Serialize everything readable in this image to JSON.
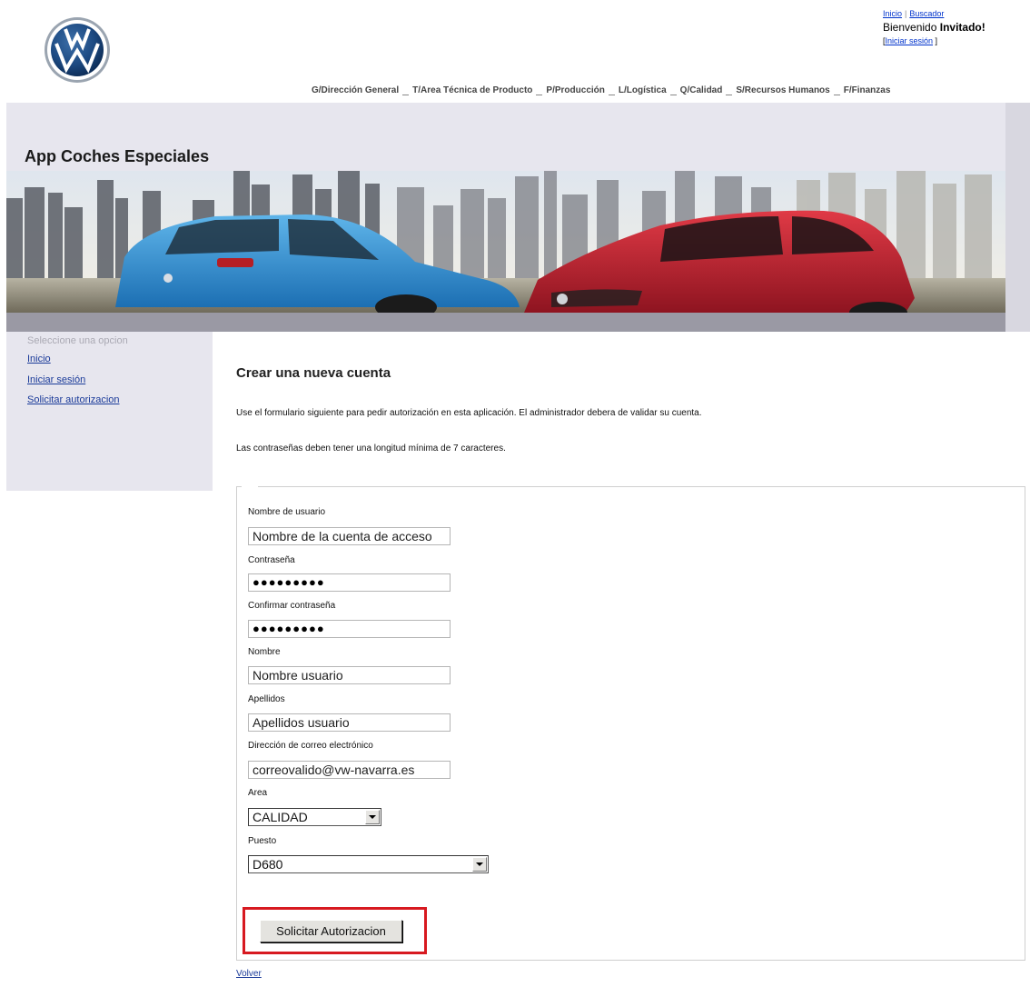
{
  "header": {
    "brand_logo": "volkswagen-logo",
    "top_links": {
      "inicio": "Inicio",
      "separator": "|",
      "buscador": "Buscador"
    },
    "welcome_text": "Bienvenido",
    "welcome_user": "Invitado!",
    "login_open": "[",
    "login_link": "Iniciar sesión",
    "login_close": " ]"
  },
  "nav": {
    "items": [
      "G/Dirección General",
      "T/Area Técnica de Producto",
      "P/Producción",
      "L/Logística",
      "Q/Calidad",
      "S/Recursos Humanos",
      "F/Finanzas"
    ]
  },
  "banner": {
    "title": "App Coches Especiales"
  },
  "sidebar": {
    "heading": "Seleccione una opcion",
    "links": [
      "Inicio",
      "Iniciar sesión",
      "Solicitar autorizacion"
    ]
  },
  "main": {
    "title": "Crear una nueva cuenta",
    "intro": "Use el formulario siguiente para pedir autorización en esta aplicación. El administrador debera de validar su cuenta.",
    "password_note": "Las contraseñas deben tener una longitud mínima de 7 caracteres.",
    "form": {
      "username_label": "Nombre de usuario",
      "username_value": "Nombre de la cuenta de acceso",
      "password_label": "Contraseña",
      "password_mask": "●●●●●●●●●",
      "confirm_label": "Confirmar contraseña",
      "confirm_mask": "●●●●●●●●●",
      "name_label": "Nombre",
      "name_value": "Nombre usuario",
      "surname_label": "Apellidos",
      "surname_value": "Apellidos usuario",
      "email_label": "Dirección de correo electrónico",
      "email_value": "correovalido@vw-navarra.es",
      "area_label": "Area",
      "area_value": "CALIDAD",
      "position_label": "Puesto",
      "position_value": "D680",
      "submit_label": "Solicitar Autorizacion"
    },
    "back_link": "Volver"
  },
  "colors": {
    "link": "#0033cc",
    "highlight_border": "#d71920",
    "sidebar_bg": "#e7e6ee"
  }
}
